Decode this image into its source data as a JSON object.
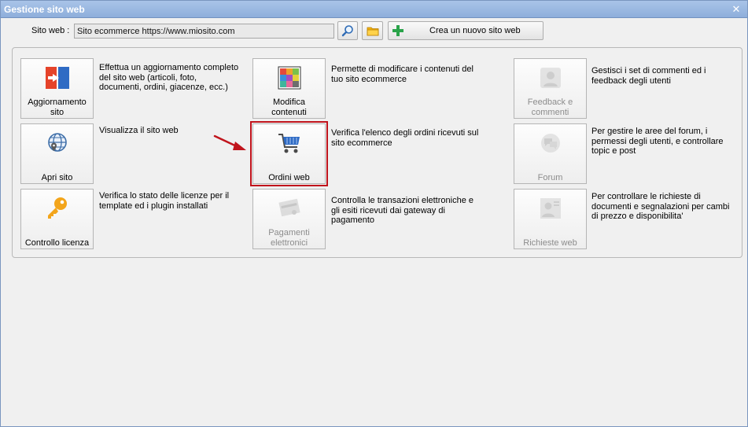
{
  "window": {
    "title": "Gestione sito web"
  },
  "toolbar": {
    "site_label": "Sito web :",
    "site_value": "Sito ecommerce https://www.miosito.com",
    "new_site_label": "Crea un nuovo sito web"
  },
  "tiles": {
    "aggiornamento": {
      "label1": "Aggiornamento",
      "label2": "sito",
      "desc": "Effettua un aggiornamento completo del sito web (articoli, foto, documenti, ordini, giacenze, ecc.)"
    },
    "apri": {
      "label": "Apri sito",
      "desc": "Visualizza il sito web"
    },
    "licenza": {
      "label": "Controllo licenza",
      "desc": "Verifica lo stato delle licenze per il template ed i plugin installati"
    },
    "modifica": {
      "label1": "Modifica",
      "label2": "contenuti",
      "desc": "Permette di modificare i contenuti del tuo sito ecommerce"
    },
    "ordini": {
      "label": "Ordini web",
      "desc": "Verifica l'elenco degli ordini ricevuti sul sito ecommerce"
    },
    "pagamenti": {
      "label1": "Pagamenti",
      "label2": "elettronici",
      "desc": "Controlla le transazioni elettroniche e gli esiti ricevuti dai gateway di pagamento"
    },
    "feedback": {
      "label1": "Feedback e",
      "label2": "commenti",
      "desc": "Gestisci i set di commenti ed i feedback degli utenti"
    },
    "forum": {
      "label": "Forum",
      "desc": "Per gestire le aree del forum, i permessi degli utenti, e controllare topic e post"
    },
    "richieste": {
      "label": "Richieste web",
      "desc": "Per controllare le richieste di documenti e segnalazioni per cambi di prezzo e disponibilita'"
    }
  },
  "colors": {
    "titlebar": "#9fbbe3",
    "highlight": "#c0141c",
    "arrow": "#c0141c"
  }
}
